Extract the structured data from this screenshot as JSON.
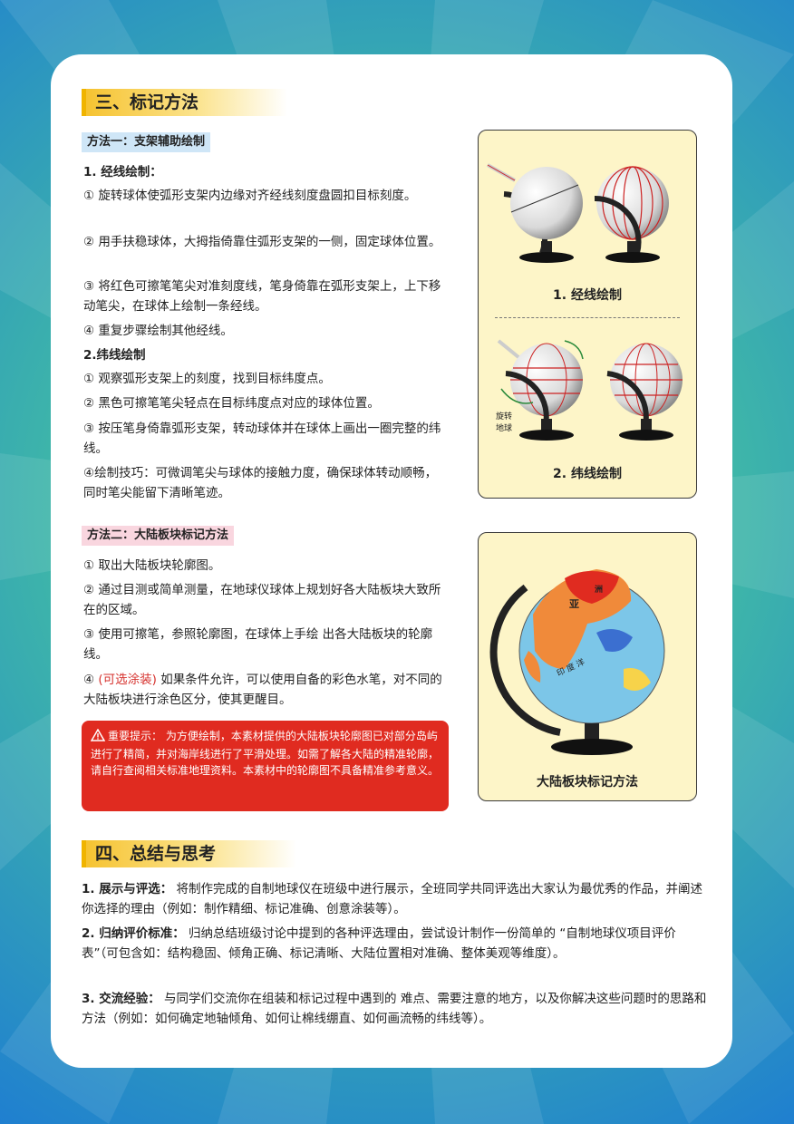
{
  "section3": {
    "title": "三、标记方法",
    "method1": {
      "tag": "方法一：支架辅助绘制",
      "sub1_title": "1. 经线绘制：",
      "sub1_steps": [
        "① 旋转球体使弧形支架内边缘对齐经线刻度盘圆扣目标刻度。",
        "② 用手扶稳球体，大拇指倚靠住弧形支架的一侧，固定球体位置。",
        "③ 将红色可擦笔笔尖对准刻度线，笔身倚靠在弧形支架上，上下移动笔尖，在球体上绘制一条经线。",
        "④ 重复步骤绘制其他经线。"
      ],
      "sub2_title": "2.纬线绘制",
      "sub2_steps": [
        "① 观察弧形支架上的刻度，找到目标纬度点。",
        "② 黑色可擦笔笔尖轻点在目标纬度点对应的球体位置。",
        "③ 按压笔身倚靠弧形支架，转动球体并在球体上画出一圈完整的纬线。",
        "④绘制技巧：可微调笔尖与球体的接触力度，确保球体转动顺畅，同时笔尖能留下清晰笔迹。"
      ]
    },
    "method2": {
      "tag": "方法二：大陆板块标记方法",
      "steps": [
        "① 取出大陆板块轮廓图。",
        "② 通过目测或简单测量，在地球仪球体上规划好各大陆板块大致所在的区域。",
        "③ 使用可擦笔，参照轮廓图，在球体上手绘 出各大陆板块的轮廓线。"
      ],
      "step4_prefix": "④ ",
      "step4_highlight": "(可选涂装)",
      "step4_text": " 如果条件允许，可以使用自备的彩色水笔，对不同的大陆板块进行涂色区分，使其更醒目。"
    },
    "warning": {
      "label": "重要提示：",
      "text": " 为方便绘制，本素材提供的大陆板块轮廓图已对部分岛屿进行了精简，并对海岸线进行了平滑处理。如需了解各大陆的精准轮廓，请自行查阅相关标准地理资料。本素材中的轮廓图不具备精准参考意义。"
    },
    "panel1": {
      "caption_a": "1. 经线绘制",
      "caption_b": "2. 纬线绘制",
      "rotate_label_1": "旋转",
      "rotate_label_2": "地球"
    },
    "panel2": {
      "caption": "大陆板块标记方法",
      "map_label_asia": "亚",
      "map_label_asia2": "洲",
      "map_label_ocean": "印 度 洋"
    }
  },
  "section4": {
    "title": "四、总结与思考",
    "items": [
      {
        "label": "1. 展示与评选：",
        "text": " 将制作完成的自制地球仪在班级中进行展示，全班同学共同评选出大家认为最优秀的作品，并阐述你选择的理由（例如：制作精细、标记准确、创意涂装等）。"
      },
      {
        "label": "2. 归纳评价标准：",
        "text": " 归纳总结班级讨论中提到的各种评选理由，尝试设计制作一份简单的 “自制地球仪项目评价表”（可包含如：结构稳固、倾角正确、标记清晰、大陆位置相对准确、整体美观等维度）。"
      },
      {
        "label": "3. 交流经验：",
        "text": " 与同学们交流你在组装和标记过程中遇到的 难点、需要注意的地方，以及你解决这些问题时的思路和方法（例如：如何确定地轴倾角、如何让棉线绷直、如何画流畅的纬线等）。"
      }
    ]
  }
}
